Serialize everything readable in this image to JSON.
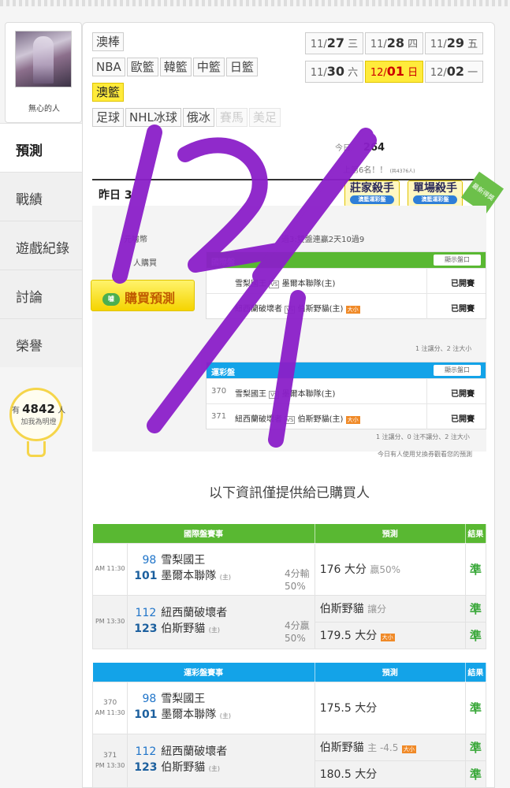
{
  "profile": {
    "name": "無心的人"
  },
  "nav": [
    {
      "label": "預測",
      "active": true
    },
    {
      "label": "戰績"
    },
    {
      "label": "遊戲紀錄"
    },
    {
      "label": "討論"
    },
    {
      "label": "榮譽"
    }
  ],
  "fans": {
    "prefix": "有",
    "count": "4842",
    "suffix": "人",
    "sub": "加我為明燈"
  },
  "sports": {
    "row1": [
      "澳棒"
    ],
    "row2": [
      "NBA",
      "歐籃",
      "韓籃",
      "中籃",
      "日籃"
    ],
    "row3": [
      "澳籃"
    ],
    "row4": [
      "足球",
      "NHL冰球",
      "俄冰",
      "賽馬",
      "美足"
    ]
  },
  "dates": [
    {
      "md": "11/",
      "day": "27",
      "wd": "三"
    },
    {
      "md": "11/",
      "day": "28",
      "wd": "四"
    },
    {
      "md": "11/",
      "day": "29",
      "wd": "五"
    },
    {
      "md": "11/",
      "day": "30",
      "wd": "六"
    },
    {
      "md": "12/",
      "day": "01",
      "wd": "日",
      "active": true
    },
    {
      "md": "12/",
      "day": "02",
      "wd": "一"
    }
  ],
  "summary": {
    "today_label": "今日",
    "today_value": "264",
    "rank": "上第6名！！",
    "rank_small": "(共4376人)",
    "yesterday": "昨日 3"
  },
  "badges": [
    {
      "title": "莊家殺手",
      "sub": "澳籃運彩盤"
    },
    {
      "title": "單場殺手",
      "sub": "澳籃運彩盤"
    }
  ],
  "ribbon": "最新得獎",
  "purchase": {
    "cost": "元噱幣",
    "buyers": "人購買",
    "record": "過3:雙盤連贏2天10過9",
    "button": "購買預測",
    "coin": "噱"
  },
  "mini_intl": {
    "title": "國際盤",
    "button": "顯示盤口",
    "rows": [
      {
        "no": "",
        "home": "雪梨國王",
        "away": "墨爾本聯隊(主)",
        "ou": false,
        "status": "已開賽"
      },
      {
        "no": "",
        "home": "紐西蘭破壞者",
        "away": "伯斯野貓(主)",
        "ou": true,
        "status": "已開賽"
      }
    ],
    "note": "1 注讓分、2 注大小"
  },
  "mini_lotto": {
    "title": "運彩盤",
    "button": "顯示盤口",
    "rows": [
      {
        "no": "370",
        "home": "雪梨國王",
        "away": "墨爾本聯隊(主)",
        "ou": false,
        "status": "已開賽"
      },
      {
        "no": "371",
        "home": "紐西蘭破壞者",
        "away": "伯斯野貓(主)",
        "ou": true,
        "status": "已開賽"
      }
    ],
    "note": "1 注讓分、0 注不讓分、2 注大小",
    "note2": "今日有人使用兌換券觀看您的預測"
  },
  "ou_badge": "大小",
  "info_title": "以下資訊僅提供給已購買人",
  "intl_table": {
    "headers": [
      "國際盤賽事",
      "預測",
      "結果"
    ],
    "games": [
      {
        "time": "AM 11:30",
        "away_num": "98",
        "away": "雪梨國王",
        "home_num": "101",
        "home": "墨爾本聯隊",
        "home_tag": "(主)",
        "spread": "4分輸",
        "spread_pct": "50%",
        "picks": [
          {
            "pick": "176 大分",
            "hint": "贏50%",
            "result": "準"
          }
        ]
      },
      {
        "time": "PM 13:30",
        "away_num": "112",
        "away": "紐西蘭破壞者",
        "home_num": "123",
        "home": "伯斯野貓",
        "home_tag": "(主)",
        "spread": "4分贏",
        "spread_pct": "50%",
        "picks": [
          {
            "pick": "伯斯野貓",
            "hint": "讓分",
            "result": "準"
          },
          {
            "pick": "179.5 大分",
            "hint": "",
            "ou": true,
            "result": "準"
          }
        ]
      }
    ]
  },
  "lotto_table": {
    "headers": [
      "運彩盤賽事",
      "預測",
      "結果"
    ],
    "games": [
      {
        "no": "370",
        "time": "AM 11:30",
        "away_num": "98",
        "away": "雪梨國王",
        "home_num": "101",
        "home": "墨爾本聯隊",
        "home_tag": "(主)",
        "picks": [
          {
            "pick": "175.5 大分",
            "hint": "",
            "result": "準"
          }
        ]
      },
      {
        "no": "371",
        "time": "PM 13:30",
        "away_num": "112",
        "away": "紐西蘭破壞者",
        "home_num": "123",
        "home": "伯斯野貓",
        "home_tag": "(主)",
        "picks": [
          {
            "pick": "伯斯野貓",
            "hint": "主 -4.5",
            "ou": true,
            "result": "準"
          },
          {
            "pick": "180.5 大分",
            "hint": "",
            "result": "準"
          }
        ]
      }
    ]
  },
  "colors": {
    "green": "#59b832",
    "blue": "#13a3e8",
    "yellow": "#ffeb3b",
    "scribble": "#8b1fc9"
  },
  "annotation": "12/1"
}
